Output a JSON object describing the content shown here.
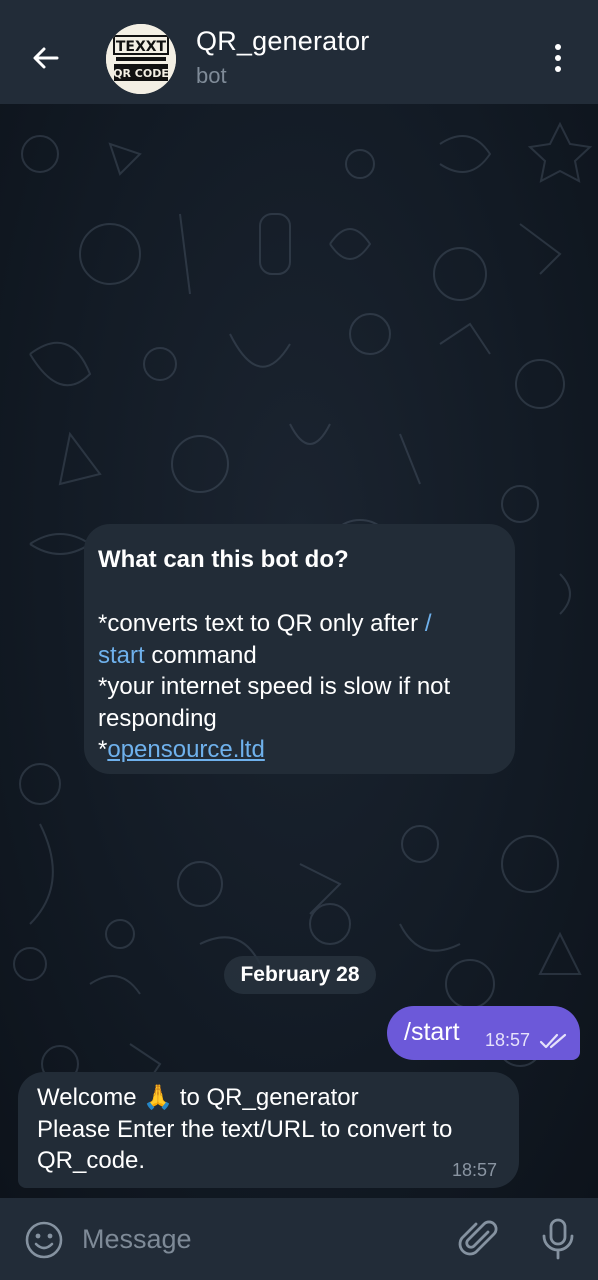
{
  "header": {
    "title": "QR_generator",
    "subtitle": "bot",
    "avatar_line1": "TEXXT",
    "avatar_line2": "QR CODE",
    "back_icon": "arrow-left-icon",
    "menu_icon": "more-vertical-icon"
  },
  "intro": {
    "title": "What can this bot do?",
    "line1_pre": "*converts text to QR only after ",
    "line1_cmd_part1": "/",
    "line1_cmd_part2": "start",
    "line1_post": " command",
    "line2": "*your internet speed is slow if not responding",
    "line3_pre": "*",
    "line3_link": "opensource.ltd"
  },
  "date_separator": "February 28",
  "messages": [
    {
      "direction": "out",
      "text": "/start",
      "time": "18:57",
      "status": "read"
    },
    {
      "direction": "in",
      "line1_pre": "Welcome ",
      "emoji": "🙏",
      "line1_post": " to QR_generator",
      "line2": "Please Enter the text/URL to convert to QR_code.",
      "time": "18:57"
    }
  ],
  "composer": {
    "placeholder": "Message",
    "emoji_icon": "smile-icon",
    "attach_icon": "paperclip-icon",
    "mic_icon": "microphone-icon"
  },
  "colors": {
    "header_bg": "#222c38",
    "bubble_in": "#222c37",
    "bubble_out": "#6c59d9",
    "link": "#6fb1ec"
  }
}
